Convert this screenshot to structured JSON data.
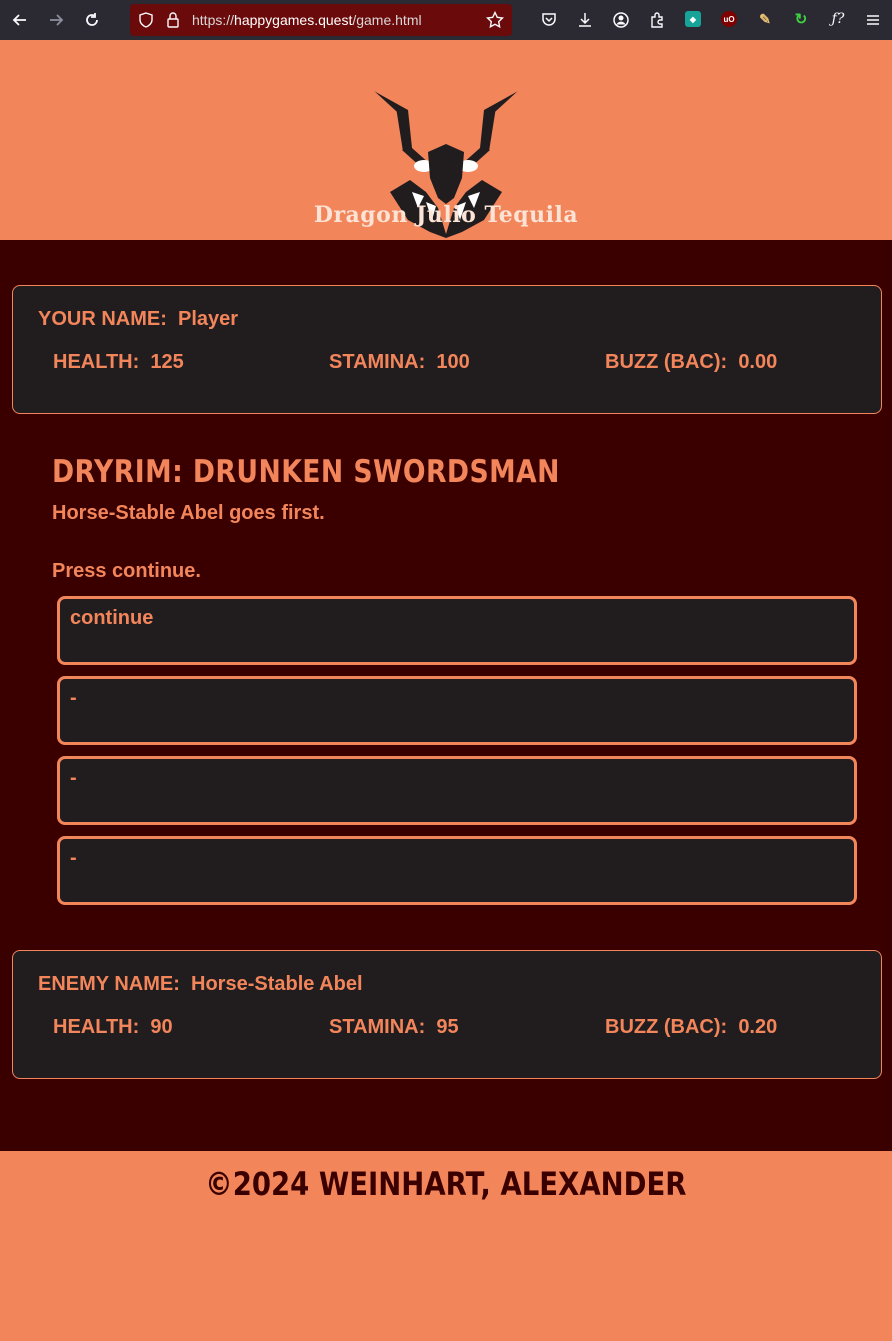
{
  "browser": {
    "url_scheme": "https://",
    "url_host": "happygames.quest",
    "url_path": "/game.html"
  },
  "header": {
    "brand": "Dragon Julio Tequila"
  },
  "player": {
    "name_label": "YOUR NAME:",
    "name": "Player",
    "health_label": "HEALTH:",
    "health": "125",
    "stamina_label": "STAMINA:",
    "stamina": "100",
    "buzz_label": "BUZZ (BAC):",
    "buzz": "0.00"
  },
  "scene": {
    "title": "DRYRIM: DRUNKEN SWORDSMAN",
    "line1": "Horse-Stable Abel goes first.",
    "line2": "Press continue."
  },
  "choices": [
    "continue",
    "-",
    "-",
    "-"
  ],
  "enemy": {
    "name_label": "ENEMY NAME:",
    "name": "Horse-Stable Abel",
    "health_label": "HEALTH:",
    "health": "90",
    "stamina_label": "STAMINA:",
    "stamina": "95",
    "buzz_label": "BUZZ (BAC):",
    "buzz": "0.20"
  },
  "footer": {
    "copyright": "©2024 WEINHART, ALEXANDER"
  },
  "colors": {
    "accent": "#f3855b",
    "background_dark": "#3a0000",
    "panel": "#211d1f"
  }
}
